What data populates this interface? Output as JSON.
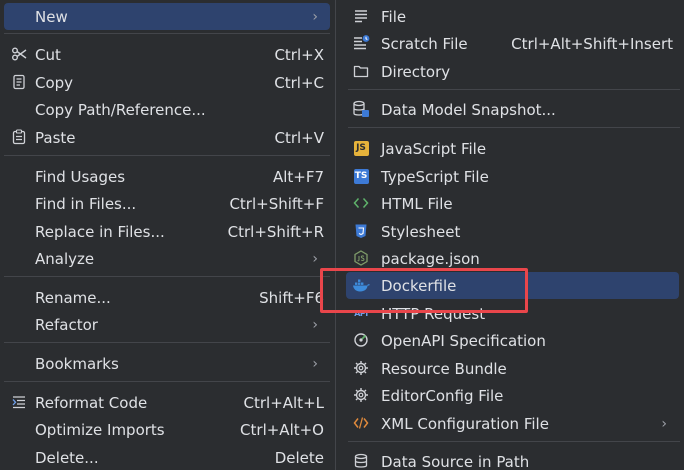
{
  "left_menu": {
    "new": "New",
    "cut": "Cut",
    "cut_sc": "Ctrl+X",
    "copy": "Copy",
    "copy_sc": "Ctrl+C",
    "copy_path": "Copy Path/Reference...",
    "paste": "Paste",
    "paste_sc": "Ctrl+V",
    "find_usages": "Find Usages",
    "find_usages_sc": "Alt+F7",
    "find_in_files": "Find in Files...",
    "find_in_files_sc": "Ctrl+Shift+F",
    "replace_in_files": "Replace in Files...",
    "replace_in_files_sc": "Ctrl+Shift+R",
    "analyze": "Analyze",
    "rename": "Rename...",
    "rename_sc": "Shift+F6",
    "refactor": "Refactor",
    "bookmarks": "Bookmarks",
    "reformat_code": "Reformat Code",
    "reformat_code_sc": "Ctrl+Alt+L",
    "optimize_imports": "Optimize Imports",
    "optimize_imports_sc": "Ctrl+Alt+O",
    "delete": "Delete...",
    "delete_sc": "Delete"
  },
  "new_submenu": {
    "file": "File",
    "scratch_file": "Scratch File",
    "scratch_file_sc": "Ctrl+Alt+Shift+Insert",
    "directory": "Directory",
    "data_model_snapshot": "Data Model Snapshot...",
    "javascript_file": "JavaScript File",
    "typescript_file": "TypeScript File",
    "html_file": "HTML File",
    "stylesheet": "Stylesheet",
    "package_json": "package.json",
    "dockerfile": "Dockerfile",
    "http_request": "HTTP Request",
    "openapi_spec": "OpenAPI Specification",
    "resource_bundle": "Resource Bundle",
    "editorconfig_file": "EditorConfig File",
    "xml_config_file": "XML Configuration File",
    "data_source_in_path": "Data Source in Path"
  },
  "icons": {
    "js_badge": "JS",
    "ts_badge": "TS",
    "api_badge": "API"
  },
  "colors": {
    "background": "#2b2d30",
    "highlight": "#2e436e",
    "annotation_box": "#e9464b",
    "js_icon": "#e6b33b",
    "ts_icon": "#3d7ad6",
    "docker_icon": "#3d8bdb"
  }
}
